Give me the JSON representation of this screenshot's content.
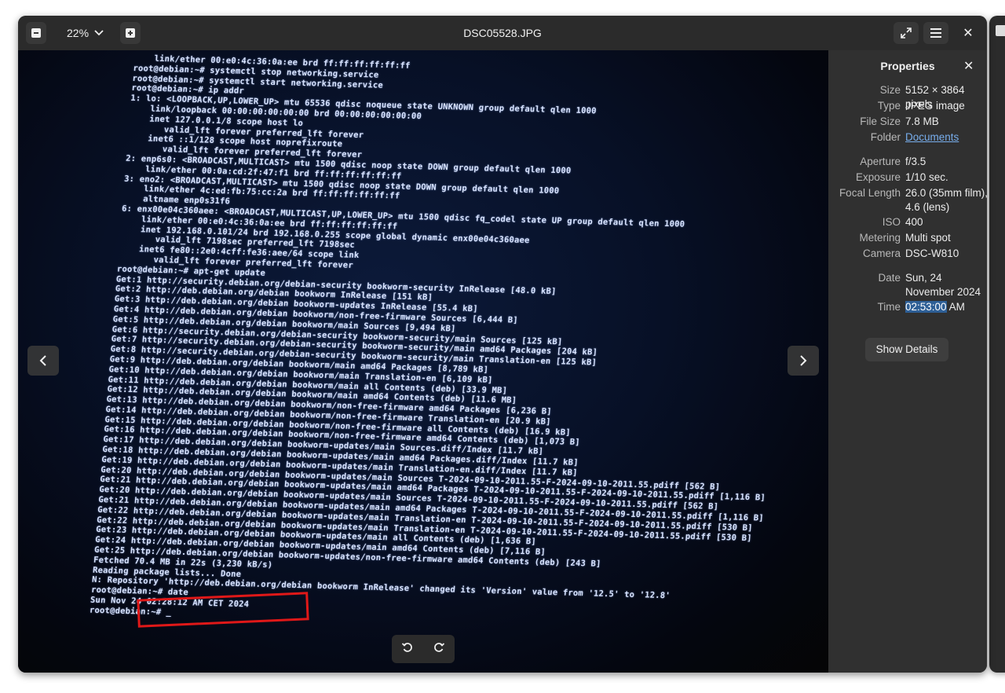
{
  "window": {
    "title": "DSC05528.JPG",
    "zoom_label": "22%"
  },
  "icons": {
    "zoom_out": "minus-square-icon",
    "zoom_in": "plus-square-icon",
    "zoom_dropdown": "chevron-down-icon",
    "fullscreen": "fullscreen-icon",
    "menu": "hamburger-menu-icon",
    "close": "close-icon",
    "prev": "chevron-left-icon",
    "next": "chevron-right-icon",
    "rotate_left": "rotate-ccw-icon",
    "rotate_right": "rotate-cw-icon"
  },
  "properties": {
    "heading": "Properties",
    "rows": [
      {
        "label": "Size",
        "value": "5152 × 3864 pixels"
      },
      {
        "label": "Type",
        "value": "JPEG image"
      },
      {
        "label": "File Size",
        "value": "7.8 MB"
      },
      {
        "label": "Folder",
        "value": "Documents"
      },
      {
        "label": "Aperture",
        "value": "f/3.5"
      },
      {
        "label": "Exposure",
        "value": "1/10 sec."
      },
      {
        "label": "Focal Length",
        "value": "26.0 (35mm film), 4.6 (lens)"
      },
      {
        "label": "ISO",
        "value": "400"
      },
      {
        "label": "Metering",
        "value": "Multi spot"
      },
      {
        "label": "Camera",
        "value": "DSC-W810"
      },
      {
        "label": "Date",
        "value": "Sun, 24 November 2024"
      },
      {
        "label": "Time",
        "value_selected": "02:53:00",
        "value_rest": " AM"
      }
    ],
    "show_details_label": "Show Details"
  },
  "photo": {
    "terminal_lines": [
      "    link/ether 00:e0:4c:36:0a:ee brd ff:ff:ff:ff:ff:ff",
      "root@debian:~# systemctl stop networking.service",
      "root@debian:~# systemctl start networking.service",
      "root@debian:~# ip addr",
      "1: lo: <LOOPBACK,UP,LOWER_UP> mtu 65536 qdisc noqueue state UNKNOWN group default qlen 1000",
      "    link/loopback 00:00:00:00:00:00 brd 00:00:00:00:00:00",
      "    inet 127.0.0.1/8 scope host lo",
      "       valid_lft forever preferred_lft forever",
      "    inet6 ::1/128 scope host noprefixroute",
      "       valid_lft forever preferred_lft forever",
      "2: enp6s0: <BROADCAST,MULTICAST> mtu 1500 qdisc noop state DOWN group default qlen 1000",
      "    link/ether 00:0a:cd:2f:47:f1 brd ff:ff:ff:ff:ff:ff",
      "3: eno2: <BROADCAST,MULTICAST> mtu 1500 qdisc noop state DOWN group default qlen 1000",
      "    link/ether 4c:ed:fb:75:cc:2a brd ff:ff:ff:ff:ff:ff",
      "    altname enp0s31f6",
      "6: enx00e04c360aee: <BROADCAST,MULTICAST,UP,LOWER_UP> mtu 1500 qdisc fq_codel state UP group default qlen 1000",
      "    link/ether 00:e0:4c:36:0a:ee brd ff:ff:ff:ff:ff:ff",
      "    inet 192.168.0.101/24 brd 192.168.0.255 scope global dynamic enx00e04c360aee",
      "       valid_lft 7198sec preferred_lft 7198sec",
      "    inet6 fe80::2e0:4cff:fe36:aee/64 scope link",
      "       valid_lft forever preferred_lft forever",
      "root@debian:~# apt-get update",
      "Get:1 http://security.debian.org/debian-security bookworm-security InRelease [48.0 kB]",
      "Get:2 http://deb.debian.org/debian bookworm InRelease [151 kB]",
      "Get:3 http://deb.debian.org/debian bookworm-updates InRelease [55.4 kB]",
      "Get:4 http://deb.debian.org/debian bookworm/non-free-firmware Sources [6,444 B]",
      "Get:5 http://deb.debian.org/debian bookworm/main Sources [9,494 kB]",
      "Get:6 http://security.debian.org/debian-security bookworm-security/main Sources [125 kB]",
      "Get:7 http://security.debian.org/debian-security bookworm-security/main amd64 Packages [204 kB]",
      "Get:8 http://security.debian.org/debian-security bookworm-security/main Translation-en [125 kB]",
      "Get:9 http://deb.debian.org/debian bookworm/main amd64 Packages [8,789 kB]",
      "Get:10 http://deb.debian.org/debian bookworm/main Translation-en [6,109 kB]",
      "Get:11 http://deb.debian.org/debian bookworm/main all Contents (deb) [33.9 MB]",
      "Get:12 http://deb.debian.org/debian bookworm/main amd64 Contents (deb) [11.6 MB]",
      "Get:13 http://deb.debian.org/debian bookworm/non-free-firmware amd64 Packages [6,236 B]",
      "Get:14 http://deb.debian.org/debian bookworm/non-free-firmware Translation-en [20.9 kB]",
      "Get:15 http://deb.debian.org/debian bookworm/non-free-firmware all Contents (deb) [16.9 kB]",
      "Get:16 http://deb.debian.org/debian bookworm/non-free-firmware amd64 Contents (deb) [1,073 B]",
      "Get:17 http://deb.debian.org/debian bookworm-updates/main Sources.diff/Index [11.7 kB]",
      "Get:18 http://deb.debian.org/debian bookworm-updates/main amd64 Packages.diff/Index [11.7 kB]",
      "Get:19 http://deb.debian.org/debian bookworm-updates/main Translation-en.diff/Index [11.7 kB]",
      "Get:20 http://deb.debian.org/debian bookworm-updates/main Sources T-2024-09-10-2011.55-F-2024-09-10-2011.55.pdiff [562 B]",
      "Get:21 http://deb.debian.org/debian bookworm-updates/main amd64 Packages T-2024-09-10-2011.55-F-2024-09-10-2011.55.pdiff [1,116 B]",
      "Get:20 http://deb.debian.org/debian bookworm-updates/main Sources T-2024-09-10-2011.55-F-2024-09-10-2011.55.pdiff [562 B]",
      "Get:21 http://deb.debian.org/debian bookworm-updates/main amd64 Packages T-2024-09-10-2011.55-F-2024-09-10-2011.55.pdiff [1,116 B]",
      "Get:22 http://deb.debian.org/debian bookworm-updates/main Translation-en T-2024-09-10-2011.55-F-2024-09-10-2011.55.pdiff [530 B]",
      "Get:22 http://deb.debian.org/debian bookworm-updates/main Translation-en T-2024-09-10-2011.55-F-2024-09-10-2011.55.pdiff [530 B]",
      "Get:23 http://deb.debian.org/debian bookworm-updates/main all Contents (deb) [1,636 B]",
      "Get:24 http://deb.debian.org/debian bookworm-updates/main amd64 Contents (deb) [7,116 B]",
      "Get:25 http://deb.debian.org/debian bookworm-updates/non-free-firmware amd64 Contents (deb) [243 B]",
      "Fetched 70.4 MB in 22s (3,230 kB/s)",
      "Reading package lists... Done",
      "N: Repository 'http://deb.debian.org/debian bookworm InRelease' changed its 'Version' value from '12.5' to '12.8'",
      "root@debian:~# date",
      "Sun Nov 24 02:28:12 AM CET 2024",
      "root@debian:~# _"
    ]
  }
}
